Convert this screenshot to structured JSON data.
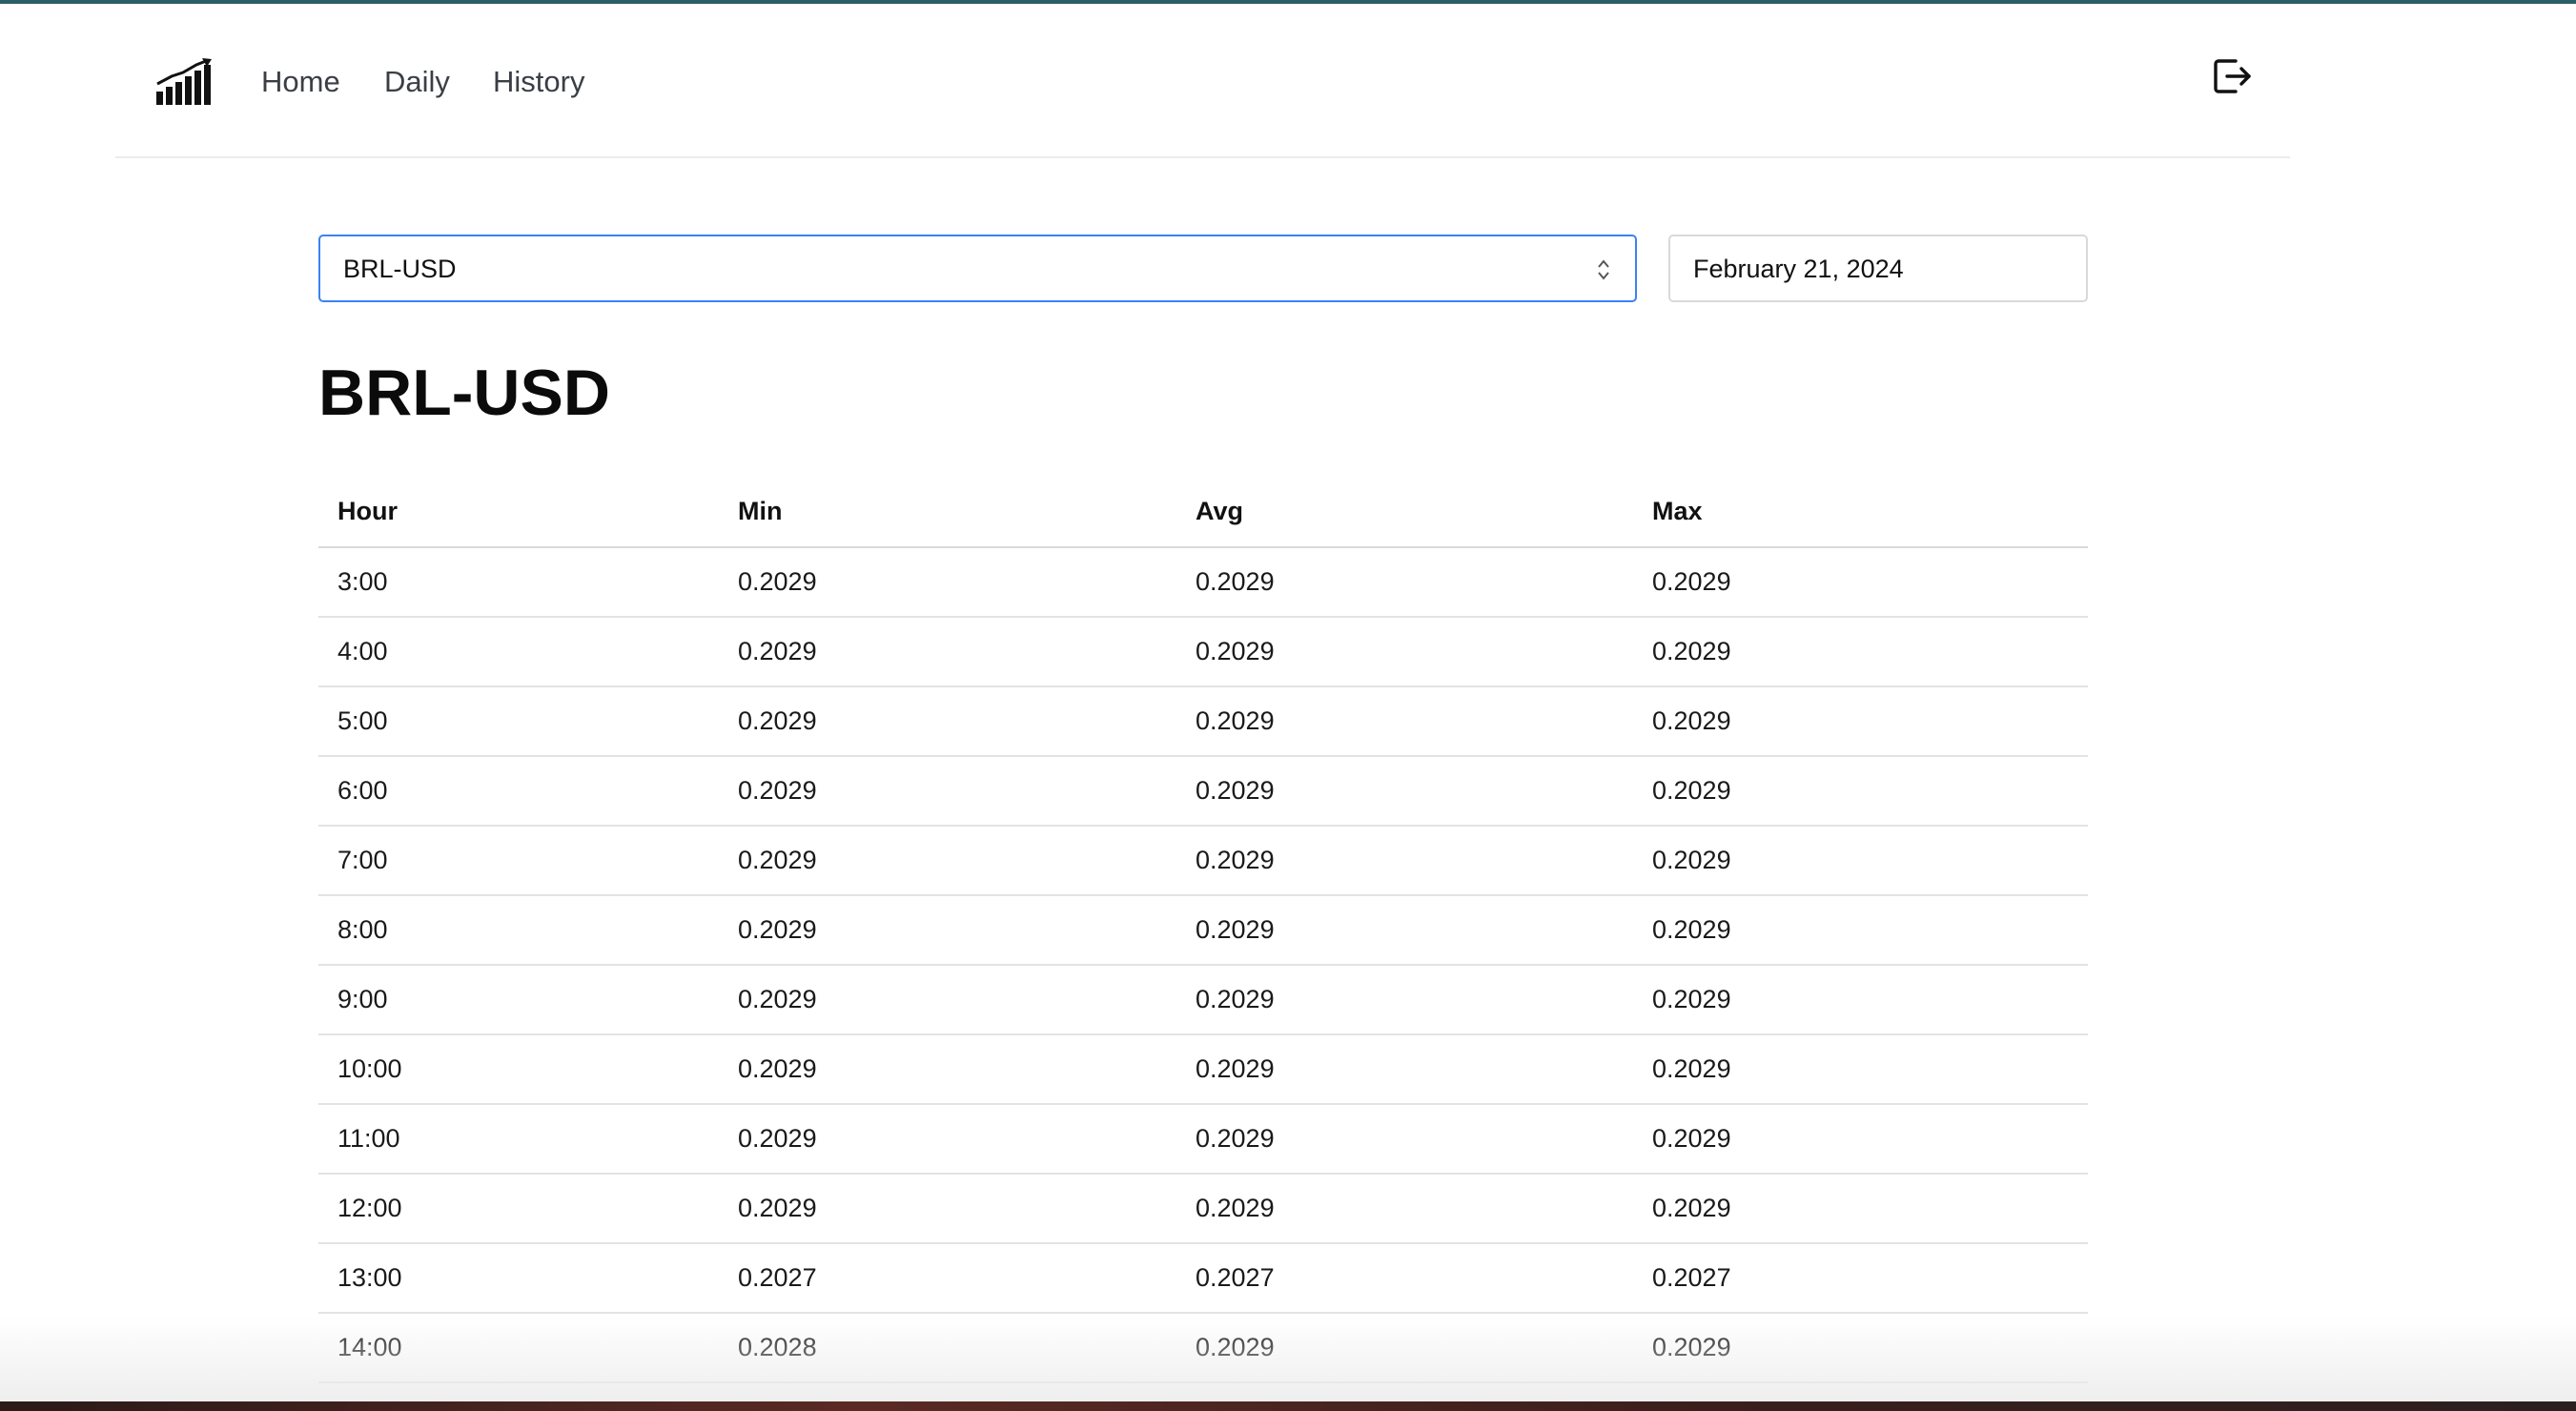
{
  "nav": {
    "links": [
      {
        "label": "Home"
      },
      {
        "label": "Daily"
      },
      {
        "label": "History"
      }
    ]
  },
  "controls": {
    "pair_selected": "BRL-USD",
    "date": "February 21, 2024"
  },
  "page": {
    "title": "BRL-USD"
  },
  "table": {
    "headers": [
      "Hour",
      "Min",
      "Avg",
      "Max"
    ],
    "rows": [
      [
        "3:00",
        "0.2029",
        "0.2029",
        "0.2029"
      ],
      [
        "4:00",
        "0.2029",
        "0.2029",
        "0.2029"
      ],
      [
        "5:00",
        "0.2029",
        "0.2029",
        "0.2029"
      ],
      [
        "6:00",
        "0.2029",
        "0.2029",
        "0.2029"
      ],
      [
        "7:00",
        "0.2029",
        "0.2029",
        "0.2029"
      ],
      [
        "8:00",
        "0.2029",
        "0.2029",
        "0.2029"
      ],
      [
        "9:00",
        "0.2029",
        "0.2029",
        "0.2029"
      ],
      [
        "10:00",
        "0.2029",
        "0.2029",
        "0.2029"
      ],
      [
        "11:00",
        "0.2029",
        "0.2029",
        "0.2029"
      ],
      [
        "12:00",
        "0.2029",
        "0.2029",
        "0.2029"
      ],
      [
        "13:00",
        "0.2027",
        "0.2027",
        "0.2027"
      ],
      [
        "14:00",
        "0.2028",
        "0.2029",
        "0.2029"
      ]
    ]
  },
  "icons": {
    "logo": "bar-chart-growth-icon",
    "logout": "logout-icon",
    "select_chevron": "chevron-up-down-icon"
  },
  "colors": {
    "accent_bar": "#2b5f66",
    "focus_border": "#3b82f6"
  }
}
